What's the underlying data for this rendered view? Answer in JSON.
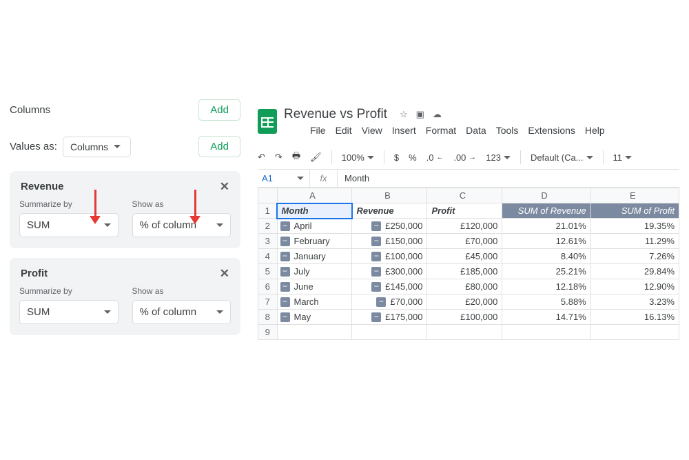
{
  "panel": {
    "columns_label": "Columns",
    "add_label": "Add",
    "values_as_label": "Values as:",
    "values_as_value": "Columns",
    "fields": [
      {
        "title": "Revenue",
        "summarize_label": "Summarize by",
        "summarize_value": "SUM",
        "showas_label": "Show as",
        "showas_value": "% of column"
      },
      {
        "title": "Profit",
        "summarize_label": "Summarize by",
        "summarize_value": "SUM",
        "showas_label": "Show as",
        "showas_value": "% of column"
      }
    ]
  },
  "sheet": {
    "doc_title": "Revenue vs Profit",
    "menus": [
      "File",
      "Edit",
      "View",
      "Insert",
      "Format",
      "Data",
      "Tools",
      "Extensions",
      "Help"
    ],
    "toolbar": {
      "zoom": "100%",
      "currency": "$",
      "percent": "%",
      "dec_dec": ".0",
      "inc_dec": ".00",
      "num_fmt": "123",
      "font": "Default (Ca...",
      "font_size": "11"
    },
    "active_cell": "A1",
    "formula_value": "Month",
    "col_letters": [
      "A",
      "B",
      "C",
      "D",
      "E"
    ],
    "headers": [
      "Month",
      "Revenue",
      "Profit",
      "SUM of Revenue",
      "SUM of Profit"
    ],
    "rows": [
      {
        "n": 2,
        "month": "April",
        "rev": "£250,000",
        "prof": "£120,000",
        "srev": "21.01%",
        "sprof": "19.35%"
      },
      {
        "n": 3,
        "month": "February",
        "rev": "£150,000",
        "prof": "£70,000",
        "srev": "12.61%",
        "sprof": "11.29%"
      },
      {
        "n": 4,
        "month": "January",
        "rev": "£100,000",
        "prof": "£45,000",
        "srev": "8.40%",
        "sprof": "7.26%"
      },
      {
        "n": 5,
        "month": "July",
        "rev": "£300,000",
        "prof": "£185,000",
        "srev": "25.21%",
        "sprof": "29.84%"
      },
      {
        "n": 6,
        "month": "June",
        "rev": "£145,000",
        "prof": "£80,000",
        "srev": "12.18%",
        "sprof": "12.90%"
      },
      {
        "n": 7,
        "month": "March",
        "rev": "£70,000",
        "prof": "£20,000",
        "srev": "5.88%",
        "sprof": "3.23%"
      },
      {
        "n": 8,
        "month": "May",
        "rev": "£175,000",
        "prof": "£100,000",
        "srev": "14.71%",
        "sprof": "16.13%"
      }
    ],
    "empty_row": 9
  }
}
